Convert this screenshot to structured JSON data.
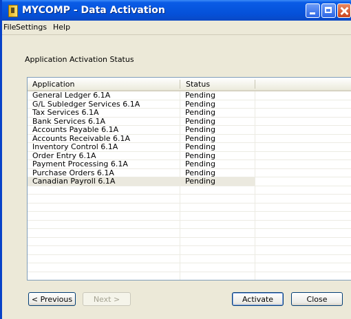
{
  "window": {
    "title": "MYCOMP - Data Activation",
    "icon": "app-icon"
  },
  "menu": {
    "items": [
      {
        "label": "File"
      },
      {
        "label": "Settings"
      },
      {
        "label": "Help"
      }
    ]
  },
  "main": {
    "group_label": "Application Activation Status",
    "columns": [
      "Application",
      "Status"
    ],
    "rows": [
      {
        "application": "General Ledger 6.1A",
        "status": "Pending"
      },
      {
        "application": "G/L Subledger Services 6.1A",
        "status": "Pending"
      },
      {
        "application": "Tax Services 6.1A",
        "status": "Pending"
      },
      {
        "application": "Bank Services 6.1A",
        "status": "Pending"
      },
      {
        "application": "Accounts Payable 6.1A",
        "status": "Pending"
      },
      {
        "application": "Accounts Receivable 6.1A",
        "status": "Pending"
      },
      {
        "application": "Inventory Control 6.1A",
        "status": "Pending"
      },
      {
        "application": "Order Entry 6.1A",
        "status": "Pending"
      },
      {
        "application": "Payment Processing 6.1A",
        "status": "Pending"
      },
      {
        "application": "Purchase Orders 6.1A",
        "status": "Pending"
      },
      {
        "application": "Canadian Payroll 6.1A",
        "status": "Pending"
      }
    ],
    "selected_row": "Canadian Payroll 6.1A"
  },
  "buttons": {
    "previous": "< Previous",
    "next": "Next >",
    "activate": "Activate",
    "close": "Close"
  },
  "colors": {
    "titlebar": "#0a5ce6",
    "window_bg": "#ece9d8",
    "selection": "#ebe9df"
  }
}
